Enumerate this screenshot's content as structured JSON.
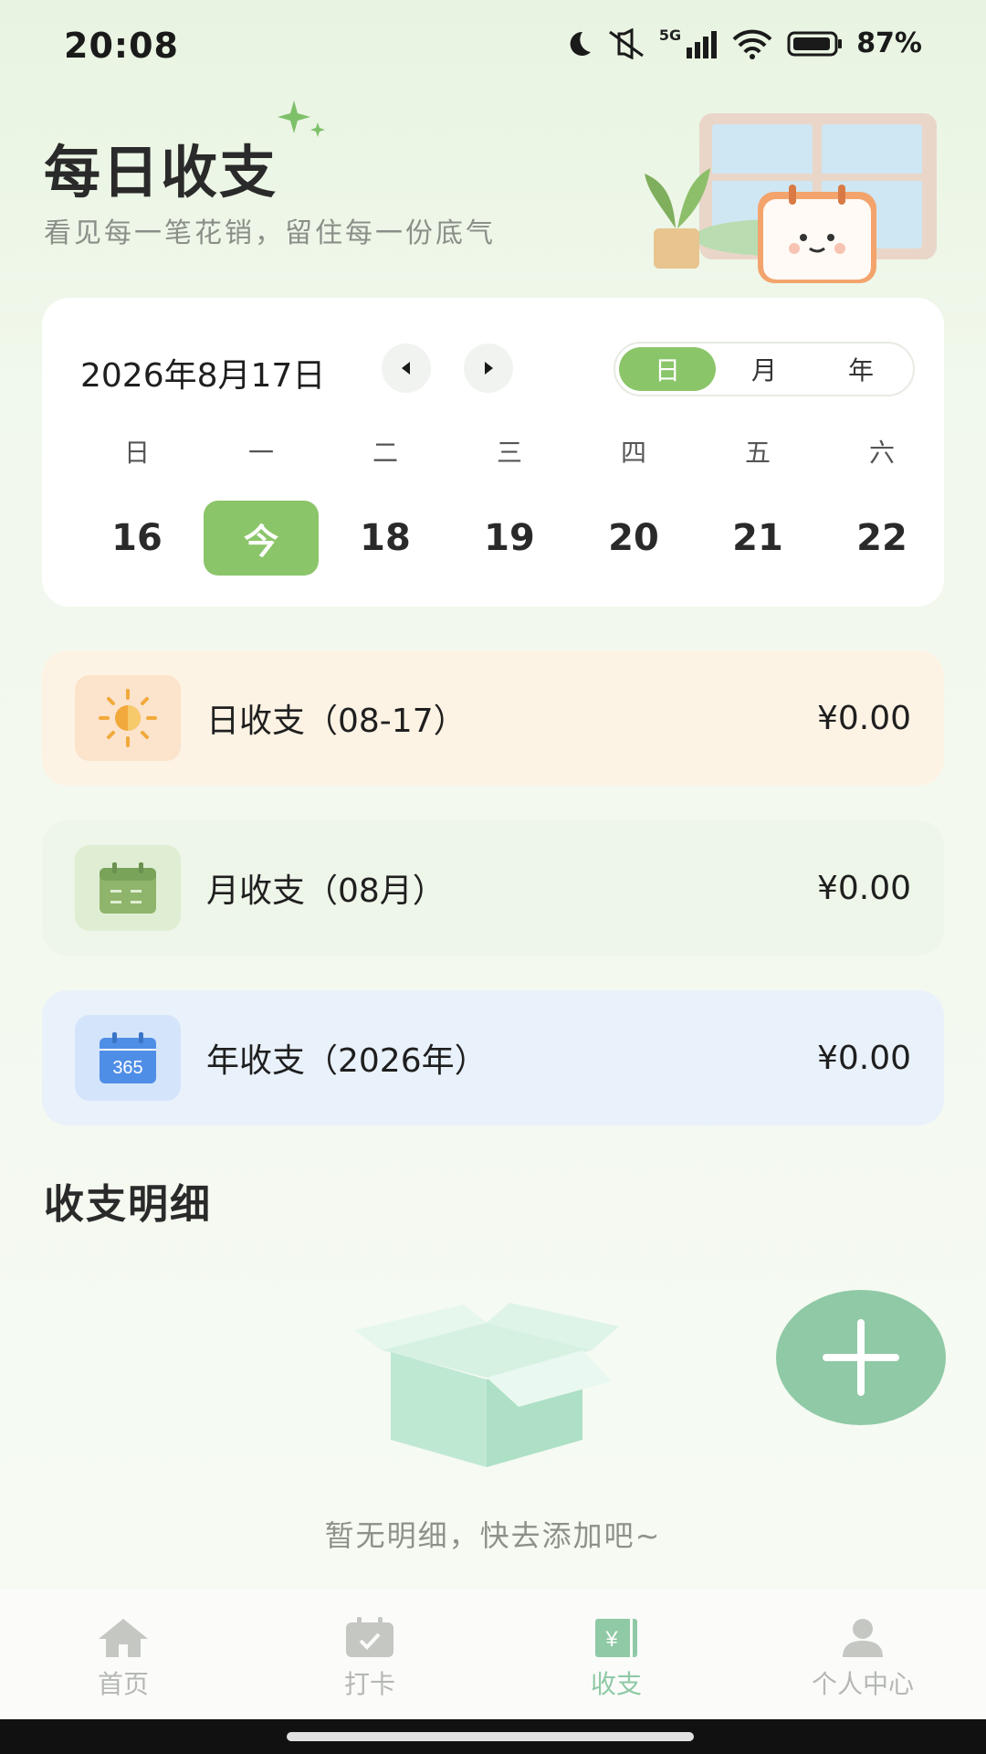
{
  "status_bar": {
    "time": "20:08",
    "network": "5G",
    "battery": "87%",
    "icons": [
      "moon-icon",
      "mute-icon",
      "signal-icon",
      "wifi-icon",
      "battery-icon"
    ]
  },
  "header": {
    "title": "每日收支",
    "subtitle": "看见每一笔花销，留住每一份底气"
  },
  "calendar": {
    "date_label": "2026年8月17日",
    "segments": [
      "日",
      "月",
      "年"
    ],
    "active_segment": "日",
    "weekdays": [
      "日",
      "一",
      "二",
      "三",
      "四",
      "五",
      "六"
    ],
    "days": [
      "16",
      "今",
      "18",
      "19",
      "20",
      "21",
      "22"
    ],
    "today_index": 1
  },
  "summaries": [
    {
      "label": "日收支（08-17）",
      "value": "¥0.00",
      "icon": "sun-icon",
      "color": "#fdf3e5"
    },
    {
      "label": "月收支（08月）",
      "value": "¥0.00",
      "icon": "calendar-icon",
      "color": "#eef5e9"
    },
    {
      "label": "年收支（2026年）",
      "value": "¥0.00",
      "icon": "calendar-365-icon",
      "color": "#e9f1fb",
      "icon_text": "365"
    }
  ],
  "details": {
    "title": "收支明细",
    "empty_text": "暂无明细，快去添加吧~"
  },
  "bottom_nav": {
    "items": [
      {
        "label": "首页",
        "icon": "home-icon"
      },
      {
        "label": "打卡",
        "icon": "checkin-icon"
      },
      {
        "label": "收支",
        "icon": "ledger-icon"
      },
      {
        "label": "个人中心",
        "icon": "person-icon"
      }
    ],
    "active": "收支"
  },
  "colors": {
    "accent_green": "#8bc56a",
    "fab_green": "#8fc9a6",
    "day_card": "#fdf3e5",
    "month_card": "#eef5e9",
    "year_card": "#e9f1fb"
  }
}
